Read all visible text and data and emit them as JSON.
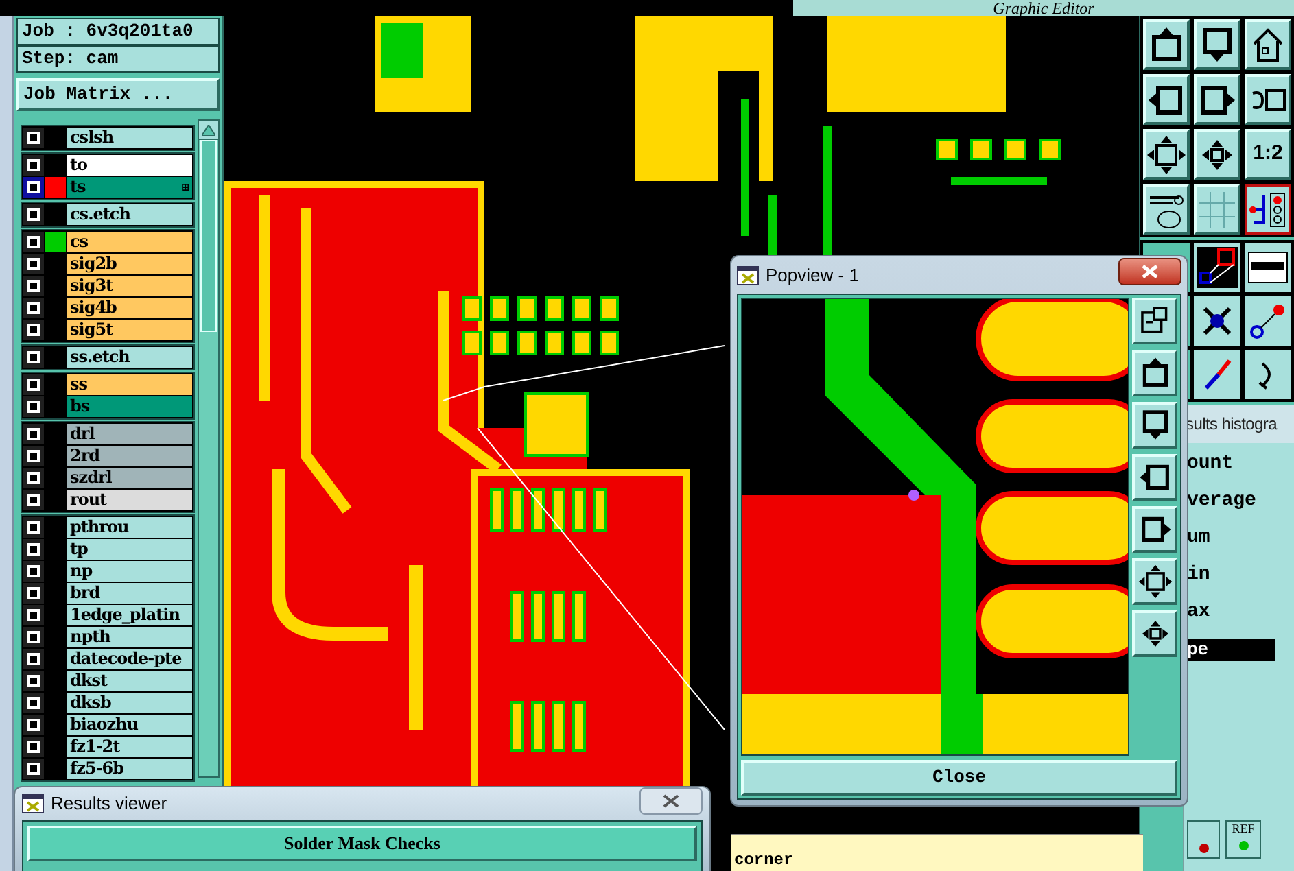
{
  "editor": {
    "title": "Graphic Editor"
  },
  "job": {
    "job_line": "Job : 6v3q201ta0",
    "step_line": "Step: cam",
    "matrix_button": "Job Matrix ..."
  },
  "layer_groups": [
    {
      "layers": [
        {
          "name": "cslsh",
          "color": "#a8e0dc",
          "active": false
        }
      ]
    },
    {
      "layers": [
        {
          "name": "to",
          "color": "#ffffff",
          "active": false
        },
        {
          "name": "ts",
          "color": "#009878",
          "active": true,
          "swatch": {
            "color": "#ff0000"
          },
          "marker": "⊞"
        }
      ]
    },
    {
      "layers": [
        {
          "name": "cs.etch",
          "color": "#a8e0dc",
          "active": false
        }
      ]
    },
    {
      "layers": [
        {
          "name": "cs",
          "color": "#ffc860",
          "active": false,
          "swatch": {
            "color": "#00cc00"
          }
        },
        {
          "name": "sig2b",
          "color": "#ffc860",
          "active": false
        },
        {
          "name": "sig3t",
          "color": "#ffc860",
          "active": false
        },
        {
          "name": "sig4b",
          "color": "#ffc860",
          "active": false
        },
        {
          "name": "sig5t",
          "color": "#ffc860",
          "active": false
        }
      ]
    },
    {
      "layers": [
        {
          "name": "ss.etch",
          "color": "#a8e0dc",
          "active": false
        }
      ]
    },
    {
      "layers": [
        {
          "name": "ss",
          "color": "#ffc860",
          "active": false
        },
        {
          "name": "bs",
          "color": "#009878",
          "active": false
        }
      ]
    },
    {
      "layers": [
        {
          "name": "drl",
          "color": "#a0b4b8",
          "active": false
        },
        {
          "name": "2rd",
          "color": "#a0b4b8",
          "active": false
        },
        {
          "name": "szdrl",
          "color": "#a0b4b8",
          "active": false
        },
        {
          "name": "rout",
          "color": "#dcdcdc",
          "active": false
        }
      ]
    },
    {
      "layers": [
        {
          "name": "pthrou",
          "color": "#a8e0dc",
          "active": false
        },
        {
          "name": "tp",
          "color": "#a8e0dc",
          "active": false
        },
        {
          "name": "np",
          "color": "#a8e0dc",
          "active": false
        },
        {
          "name": "brd",
          "color": "#a8e0dc",
          "active": false
        },
        {
          "name": "1edge_platin",
          "color": "#a8e0dc",
          "active": false
        },
        {
          "name": "npth",
          "color": "#a8e0dc",
          "active": false
        },
        {
          "name": "datecode-pte",
          "color": "#a8e0dc",
          "active": false
        },
        {
          "name": "dkst",
          "color": "#a8e0dc",
          "active": false
        },
        {
          "name": "dksb",
          "color": "#a8e0dc",
          "active": false
        },
        {
          "name": "biaozhu",
          "color": "#a8e0dc",
          "active": false
        },
        {
          "name": "fz1-2t",
          "color": "#a8e0dc",
          "active": false
        },
        {
          "name": "fz5-6b",
          "color": "#a8e0dc",
          "active": false
        }
      ]
    }
  ],
  "toolbar": {
    "buttons": [
      {
        "kind": "icon",
        "selected": false
      },
      {
        "kind": "icon",
        "selected": false
      },
      {
        "kind": "icon",
        "selected": false
      },
      {
        "kind": "icon",
        "selected": false
      },
      {
        "kind": "icon",
        "selected": false
      },
      {
        "kind": "icon",
        "selected": false
      },
      {
        "kind": "icon",
        "selected": false
      },
      {
        "kind": "icon",
        "selected": false
      },
      {
        "kind": "text",
        "label": "1:2",
        "selected": false
      },
      {
        "kind": "icon",
        "selected": false
      },
      {
        "kind": "icon",
        "selected": false
      },
      {
        "kind": "icon",
        "selected": true
      }
    ]
  },
  "histogram": {
    "title": "sults histogra",
    "stats": [
      "ount",
      "verage",
      "um",
      "in",
      "ax"
    ],
    "list_items": [
      {
        "label": "pe",
        "selected": true
      }
    ],
    "ref_button": "REF"
  },
  "popview": {
    "title": "Popview - 1",
    "close_button": "Close"
  },
  "results_viewer": {
    "title": "Results viewer",
    "category_button": "Solder Mask Checks"
  },
  "under_text": "corner"
}
